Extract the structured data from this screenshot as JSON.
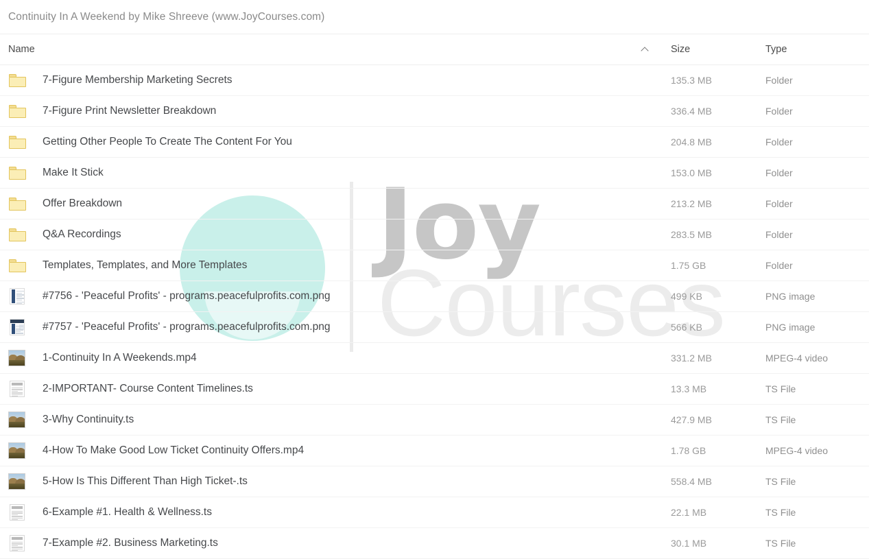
{
  "window": {
    "title": "Continuity In A Weekend by Mike Shreeve (www.JoyCourses.com)"
  },
  "watermark": {
    "word_bold": "Joy",
    "word_light": "Courses",
    "logo_color": "#c9f0ea",
    "text_bold_color": "#c6c6c6",
    "text_light_color": "#ececec"
  },
  "columns": {
    "name": "Name",
    "size": "Size",
    "type": "Type",
    "sort_indicator": "chevron-up",
    "sorted_by": "Name",
    "sort_direction": "ascending"
  },
  "files": [
    {
      "name": "7-Figure Membership Marketing Secrets",
      "size": "135.3 MB",
      "type": "Folder",
      "icon": "folder"
    },
    {
      "name": "7-Figure Print Newsletter Breakdown",
      "size": "336.4 MB",
      "type": "Folder",
      "icon": "folder"
    },
    {
      "name": "Getting Other People To Create The Content For You",
      "size": "204.8 MB",
      "type": "Folder",
      "icon": "folder"
    },
    {
      "name": "Make It Stick",
      "size": "153.0 MB",
      "type": "Folder",
      "icon": "folder"
    },
    {
      "name": "Offer Breakdown",
      "size": "213.2 MB",
      "type": "Folder",
      "icon": "folder"
    },
    {
      "name": "Q&A Recordings",
      "size": "283.5 MB",
      "type": "Folder",
      "icon": "folder"
    },
    {
      "name": "Templates, Templates, and More Templates",
      "size": "1.75 GB",
      "type": "Folder",
      "icon": "folder"
    },
    {
      "name": "#7756 - 'Peaceful Profits' - programs.peacefulprofits.com.png",
      "size": "499 KB",
      "type": "PNG image",
      "icon": "screenshot-narrow"
    },
    {
      "name": "#7757 - 'Peaceful Profits' - programs.peacefulprofits.com.png",
      "size": "566 KB",
      "type": "PNG image",
      "icon": "screenshot-wide"
    },
    {
      "name": "1-Continuity In A Weekends.mp4",
      "size": "331.2 MB",
      "type": "MPEG-4 video",
      "icon": "photo"
    },
    {
      "name": "2-IMPORTANT- Course Content Timelines.ts",
      "size": "13.3 MB",
      "type": "TS File",
      "icon": "document"
    },
    {
      "name": "3-Why Continuity.ts",
      "size": "427.9 MB",
      "type": "TS File",
      "icon": "photo"
    },
    {
      "name": "4-How To Make Good Low Ticket Continuity Offers.mp4",
      "size": "1.78 GB",
      "type": "MPEG-4 video",
      "icon": "photo"
    },
    {
      "name": "5-How Is This Different Than High Ticket-.ts",
      "size": "558.4 MB",
      "type": "TS File",
      "icon": "photo"
    },
    {
      "name": "6-Example #1. Health & Wellness.ts",
      "size": "22.1 MB",
      "type": "TS File",
      "icon": "document"
    },
    {
      "name": "7-Example #2. Business Marketing.ts",
      "size": "30.1 MB",
      "type": "TS File",
      "icon": "document"
    }
  ]
}
